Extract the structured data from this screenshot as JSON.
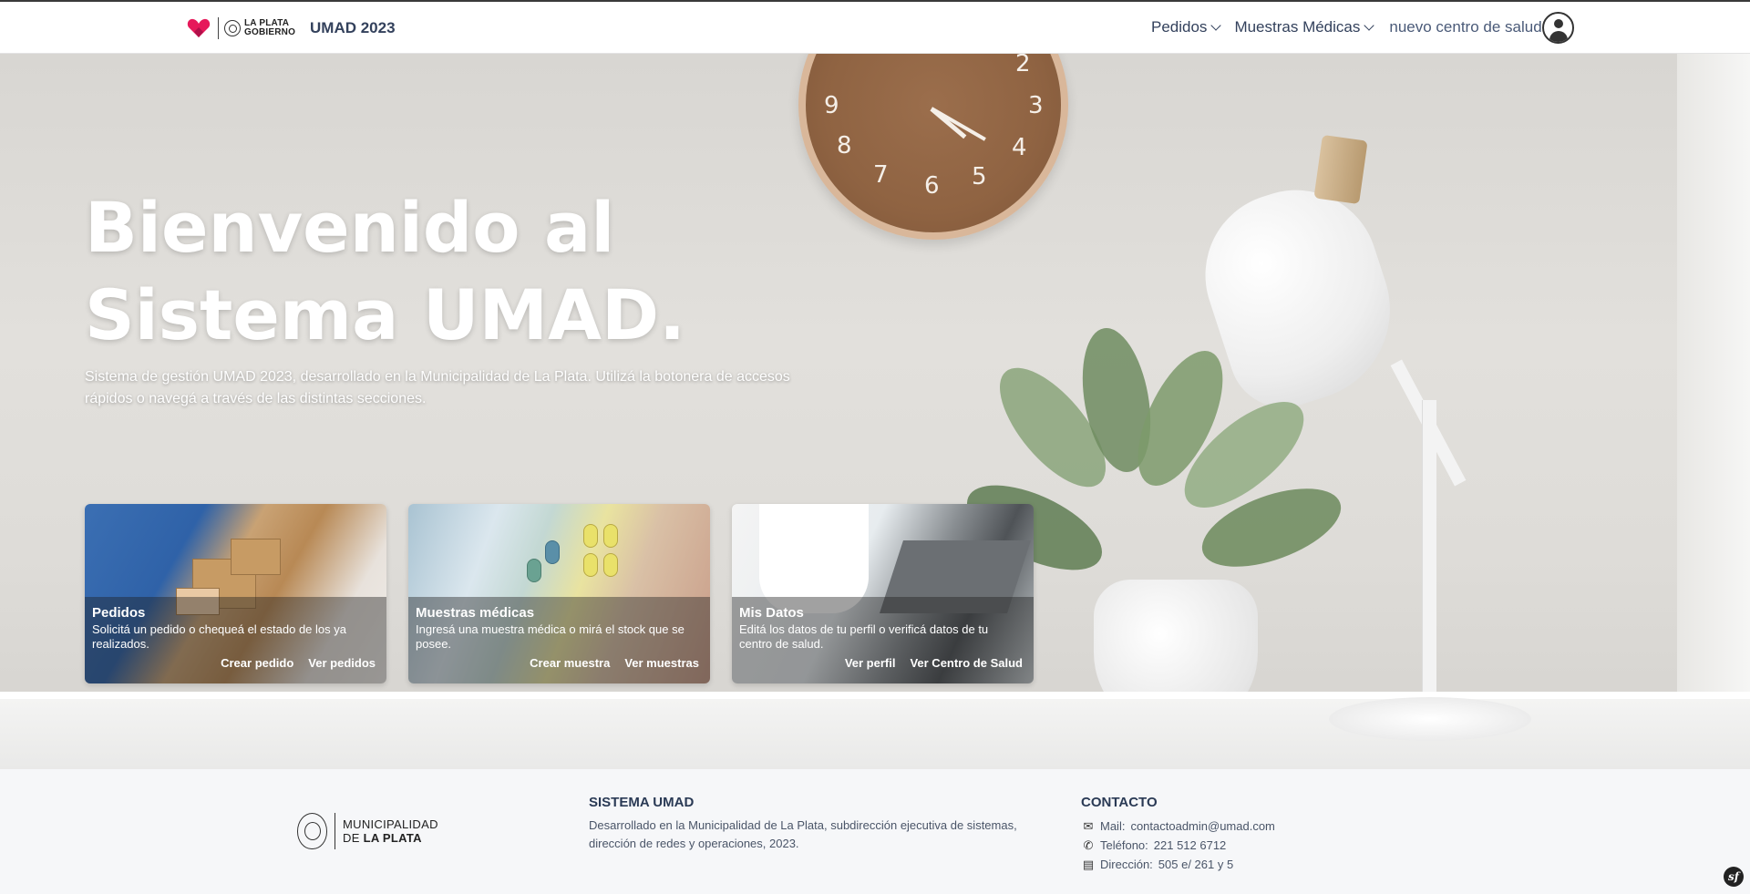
{
  "header": {
    "brand_line1": "LA PLATA",
    "brand_line2": "GOBIERNO",
    "app_title": "UMAD 2023",
    "nav": [
      {
        "label": "Pedidos"
      },
      {
        "label": "Muestras Médicas"
      }
    ],
    "center_label": "nuevo centro de salud",
    "user_icon": "user-circle-icon"
  },
  "hero": {
    "title_line1": "Bienvenido al",
    "title_line2": "Sistema UMAD.",
    "subtitle": "Sistema de gestión UMAD 2023, desarrollado en la Municipalidad de La Plata. Utilizá la botonera de accesos rápidos o navegá a través de las distintas secciones."
  },
  "cards": [
    {
      "title": "Pedidos",
      "description": "Solicitá un pedido o chequeá el estado de los ya realizados.",
      "actions": [
        "Crear pedido",
        "Ver pedidos"
      ]
    },
    {
      "title": "Muestras médicas",
      "description": "Ingresá una muestra médica o mirá el stock que se posee.",
      "actions": [
        "Crear muestra",
        "Ver muestras"
      ]
    },
    {
      "title": "Mis Datos",
      "description": "Editá los datos de tu perfil o verificá datos de tu centro de salud.",
      "actions": [
        "Ver perfil",
        "Ver Centro de Salud"
      ]
    }
  ],
  "clock_numbers": [
    "9",
    "8",
    "7",
    "6",
    "5",
    "4",
    "3",
    "2"
  ],
  "footer": {
    "logo_line1": "MUNICIPALIDAD",
    "logo_line2a": "DE ",
    "logo_line2b": "LA PLATA",
    "about_title": "SISTEMA UMAD",
    "about_text": "Desarrollado en la Municipalidad de La Plata, subdirección ejecutiva de sistemas, dirección de redes y operaciones, 2023.",
    "contact_title": "CONTACTO",
    "contact": [
      {
        "icon": "envelope-icon",
        "label": "Mail:",
        "value": "contactoadmin@umad.com"
      },
      {
        "icon": "phone-icon",
        "label": "Teléfono:",
        "value": "221 512 6712"
      },
      {
        "icon": "map-icon",
        "label": "Dirección:",
        "value": "505 e/ 261 y 5"
      }
    ],
    "badge": "sf"
  },
  "colors": {
    "accent_heart": "#e6195a",
    "nav_text": "#33415c",
    "footer_bg": "#f6f7f9"
  }
}
